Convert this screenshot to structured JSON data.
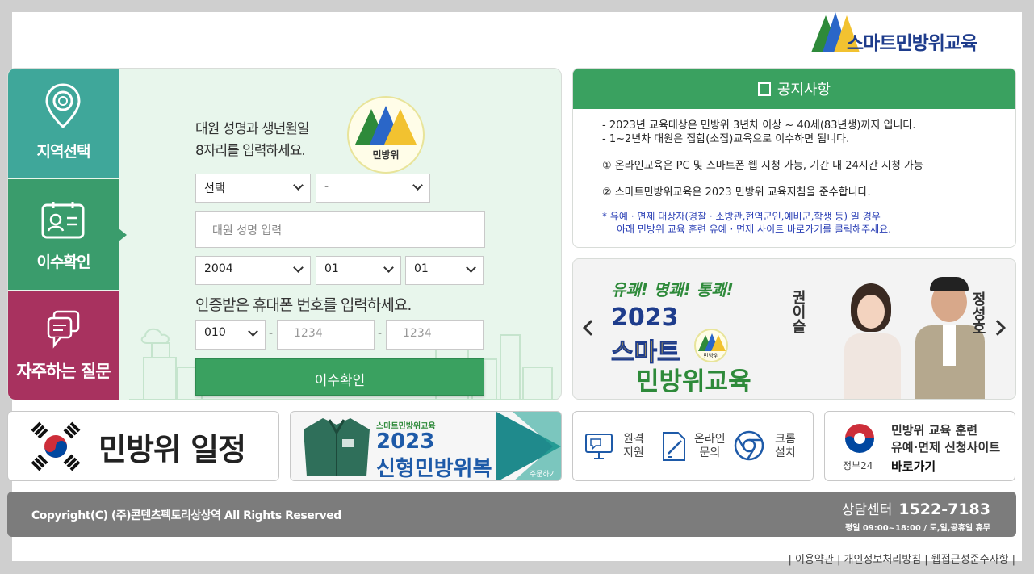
{
  "header": {
    "logo_text": "스마트민방위교육"
  },
  "sidebar": {
    "tabs": [
      {
        "label": "지역선택"
      },
      {
        "label": "이수확인"
      },
      {
        "label": "자주하는 질문"
      }
    ]
  },
  "form": {
    "instruction": "대원 성명과 생년월일\n8자리를 입력하세요.",
    "logo_label": "민방위",
    "region_select": "선택",
    "district_select": "-",
    "name_placeholder": "대원 성명 입력",
    "birth_year": "2004",
    "birth_month": "01",
    "birth_day": "01",
    "phone_label": "인증받은 휴대폰 번호를 입력하세요.",
    "phone_prefix": "010",
    "phone_mid_placeholder": "1234",
    "phone_last_placeholder": "1234",
    "phone_separator": "-",
    "submit_label": "이수확인"
  },
  "notice": {
    "title": "공지사항",
    "lines": [
      "- 2023년 교육대상은 민방위 3년차 이상 ~ 40세(83년생)까지 입니다.",
      "- 1~2년차 대원은 집합(소집)교육으로 이수하면 됩니다.",
      "① 온라인교육은 PC 및 스마트폰 웹 시청 가능, 기간 내 24시간 시청 가능",
      "② 스마트민방위교육은 2023 민방위 교육지침을 준수합니다."
    ],
    "note_line1": "* 유예 · 면제 대상자(경찰 · 소방관,현역군인,예비군,학생 등) 일 경우",
    "note_line2": "아래 민방위 교육 훈련 유예 · 면제 사이트 바로가기를 클릭해주세요."
  },
  "banner": {
    "cheer": "유쾌! 명쾌! 통쾌!",
    "year": "2023",
    "title_line1": "스마트",
    "title_line2": "민방위교육",
    "logo_label": "민방위",
    "person1": "권이슬",
    "person2": "정성호"
  },
  "bottom": {
    "schedule_label": "민방위 일정",
    "uniform_small": "스마트민방위교육",
    "uniform_year": "2023",
    "uniform_title": "신형민방위복",
    "uniform_order": "주문하기",
    "services": [
      {
        "label1": "원격",
        "label2": "지원"
      },
      {
        "label1": "온라인",
        "label2": "문의"
      },
      {
        "label1": "크롬",
        "label2": "설치"
      }
    ],
    "gov_line1": "민방위 교육 훈련",
    "gov_line2": "유예·면제 신청사이트",
    "gov_go": "바로가기",
    "gov_brand": "정부24"
  },
  "footer": {
    "copyright": "Copyright(C) (주)콘텐츠펙토리상상역 All Rights Reserved",
    "cs_label": "상담센터",
    "cs_phone": "1522-7183",
    "cs_hours": "평일 09:00~18:00 / 토,일,공휴일 휴무"
  },
  "footer_links": "| 이용약관 | 개인정보처리방침 | 웹접근성준수사항 |"
}
